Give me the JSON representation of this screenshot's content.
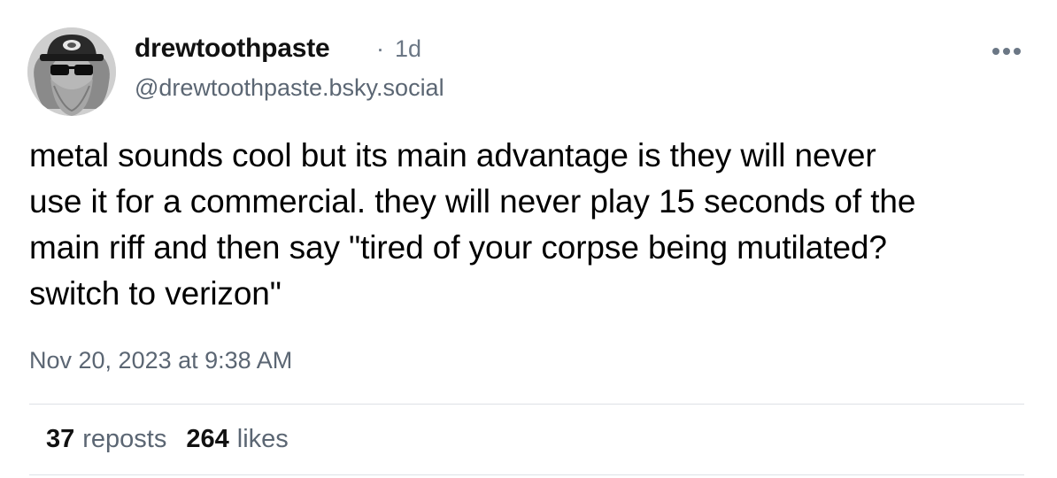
{
  "author": {
    "display_name": "drewtoothpaste",
    "separator": "·",
    "age": "1d",
    "handle": "@drewtoothpaste.bsky.social",
    "avatar_icon": "profile-photo-avatar"
  },
  "menu": {
    "icon": "more-horizontal-icon"
  },
  "post": {
    "lines": [
      "metal sounds cool but its main advantage is they will never",
      "use it for a commercial. they will never play 15 seconds of the",
      "main riff and then say \"tired of your corpse being mutilated?",
      "switch to verizon\""
    ],
    "timestamp": "Nov 20, 2023 at 9:38 AM"
  },
  "stats": {
    "reposts_count": "37",
    "reposts_label": "reposts",
    "likes_count": "264",
    "likes_label": "likes"
  },
  "colors": {
    "secondary_text": "#5b6673",
    "divider": "#dde1e6"
  }
}
